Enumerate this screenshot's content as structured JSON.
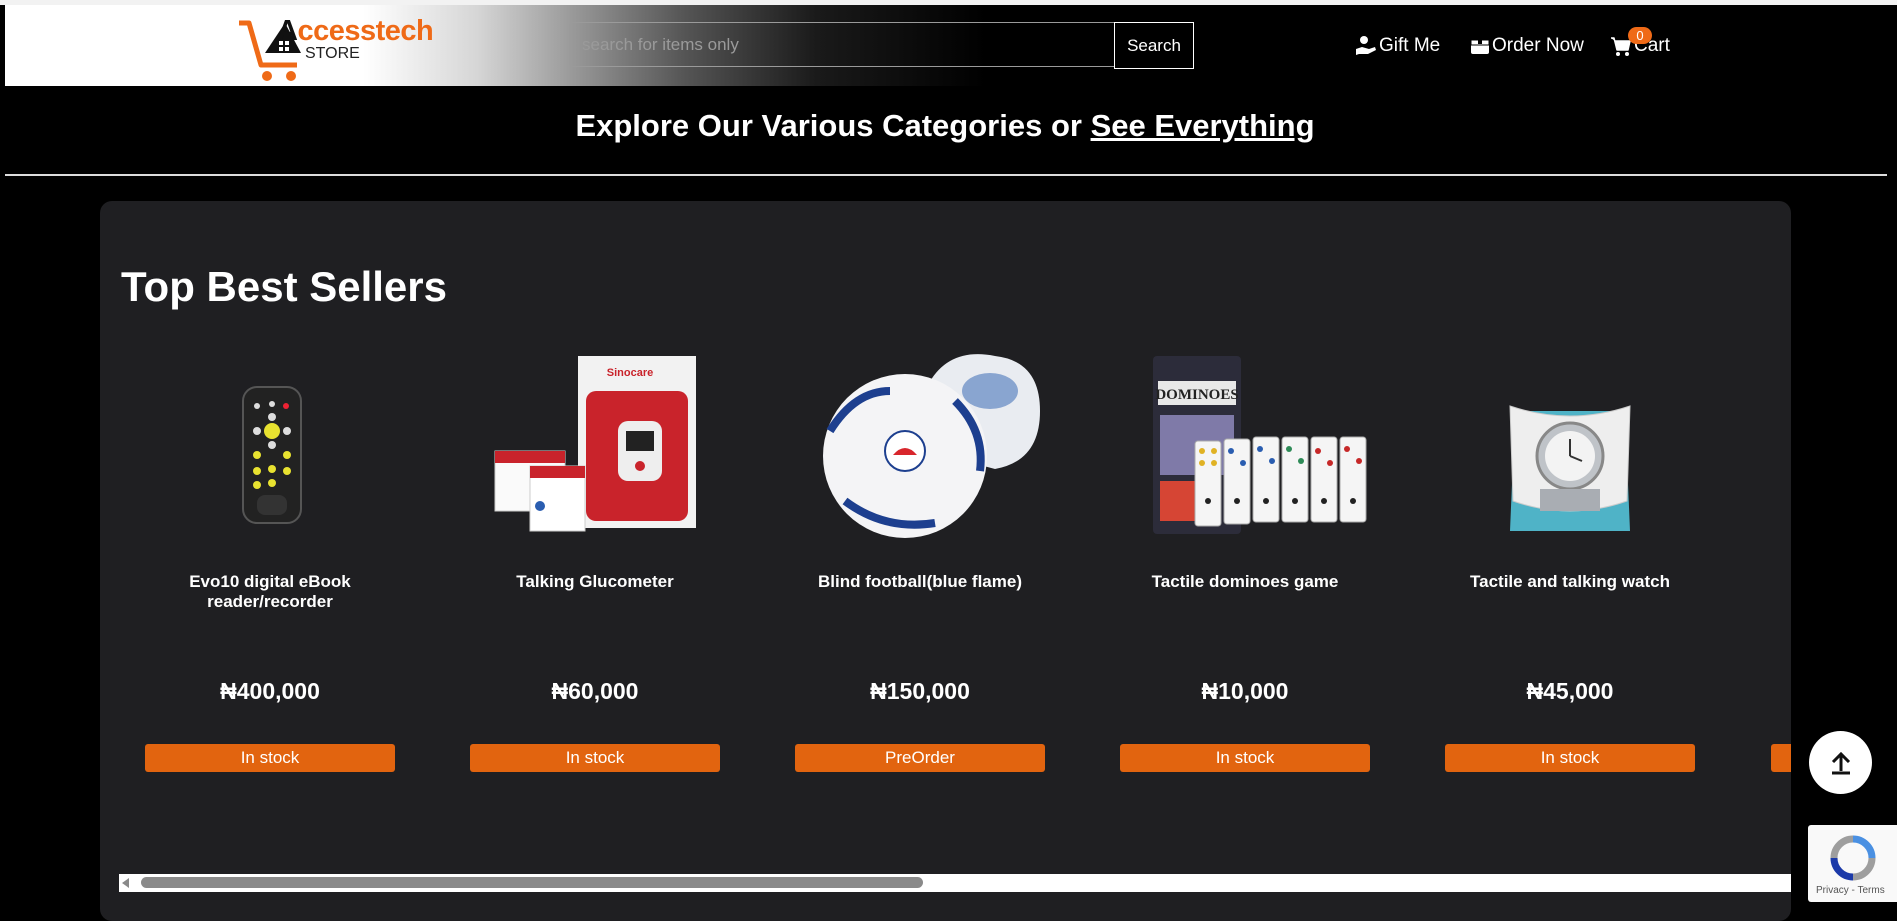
{
  "header": {
    "logo": {
      "text_dark": "A",
      "text_brand": "ccesstech",
      "sub": "STORE"
    },
    "search": {
      "placeholder": "search for items only",
      "button_label": "Search"
    },
    "nav": [
      {
        "label": "Gift Me",
        "icon": "gift-hand-icon"
      },
      {
        "label": "Order Now",
        "icon": "box-icon"
      },
      {
        "label": "Cart",
        "icon": "cart-icon",
        "badge": "0"
      }
    ]
  },
  "banner": {
    "prefix": "Explore Our Various Categories or ",
    "link": "See Everything"
  },
  "section": {
    "title": "Top Best Sellers",
    "products": [
      {
        "name": "Evo10 digital eBook reader/recorder",
        "price": "₦400,000",
        "status": "In stock"
      },
      {
        "name": "Talking Glucometer",
        "price": "₦60,000",
        "status": "In stock"
      },
      {
        "name": "Blind football(blue flame)",
        "price": "₦150,000",
        "status": "PreOrder"
      },
      {
        "name": "Tactile dominoes game",
        "price": "₦10,000",
        "status": "In stock"
      },
      {
        "name": "Tactile and talking watch",
        "price": "₦45,000",
        "status": "In stock"
      }
    ]
  },
  "recaptcha": {
    "links": "Privacy - Terms"
  },
  "colors": {
    "accent": "#e2640f",
    "panel": "#1f1f22",
    "background": "#000000"
  }
}
